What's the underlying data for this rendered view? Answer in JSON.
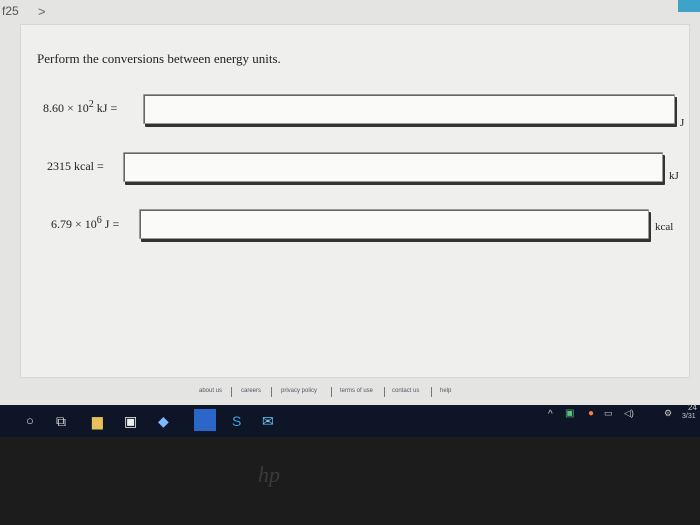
{
  "breadcrumb": {
    "number": "f25",
    "arrow": ">"
  },
  "question": "Perform the conversions between energy units.",
  "rows": [
    {
      "label_html": "8.60 × 10<sup>2</sup> kJ =",
      "value": "",
      "unit": "J"
    },
    {
      "label_html": "2315 kcal =",
      "value": "",
      "unit": "kJ"
    },
    {
      "label_html": "6.79 × 10<sup>6</sup> J =",
      "value": "",
      "unit": "kcal"
    }
  ],
  "footer": {
    "links": [
      "about us",
      "careers",
      "privacy policy",
      "terms of use",
      "contact us",
      "help"
    ]
  },
  "taskbar": {
    "clock_time": "24",
    "clock_date": "3/31"
  },
  "brand": "hp"
}
